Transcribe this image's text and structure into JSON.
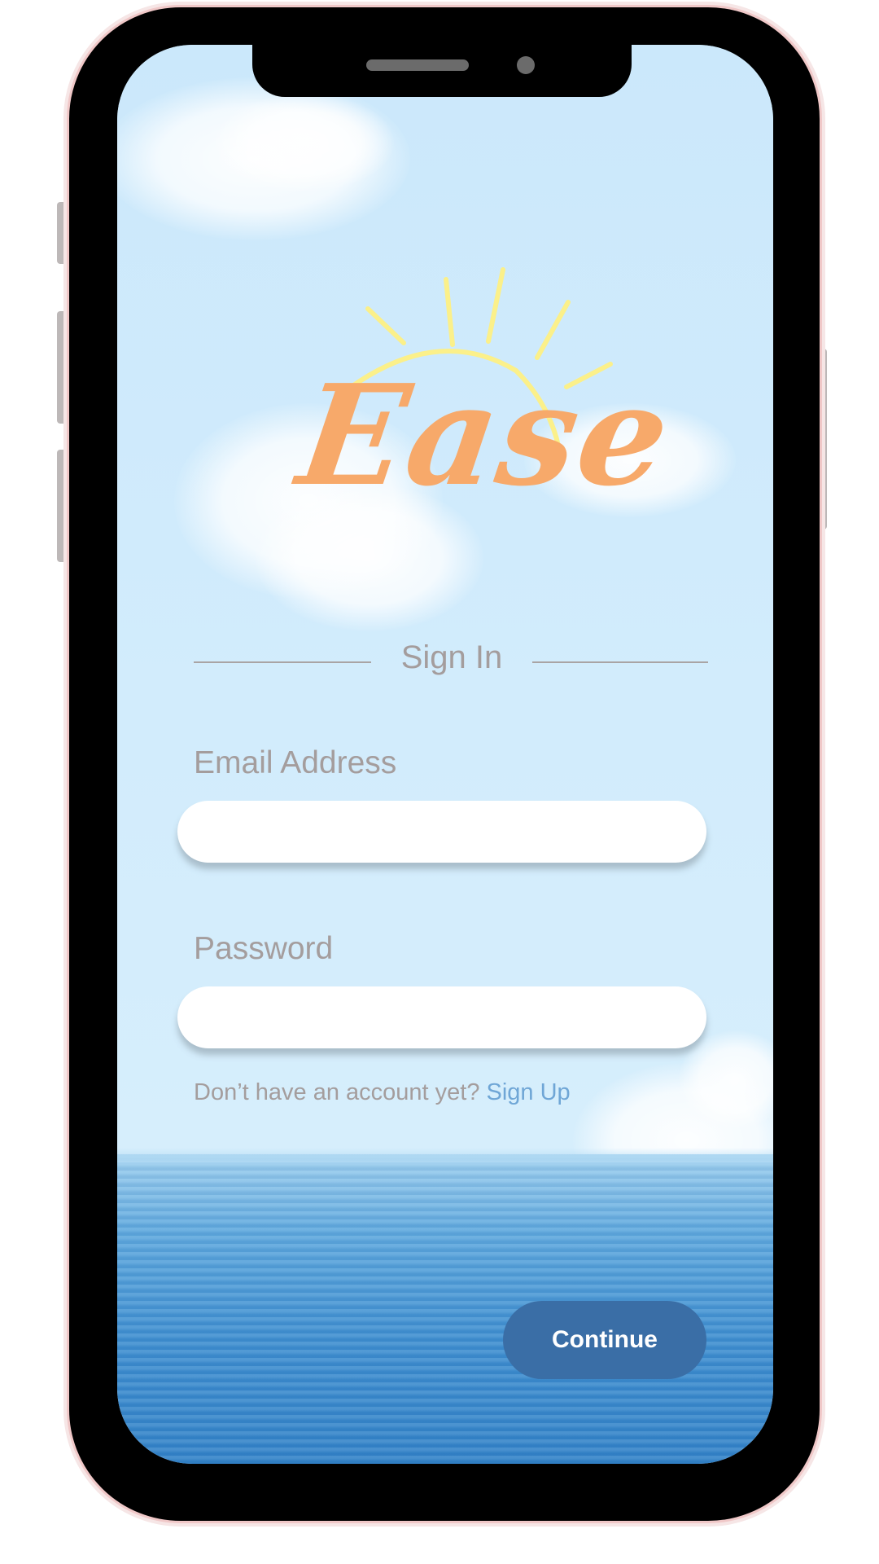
{
  "app": {
    "logo_text": "Ease",
    "logo_icon": "sun-icon",
    "colors": {
      "logo": "#f7a96a",
      "sun": "#fbf08a",
      "sky": "#cfeafb",
      "sea": "#3f8fd0",
      "label_text": "#a49d9d",
      "link": "#6fa6d6",
      "button": "#3a6ea6"
    }
  },
  "sign_in": {
    "title": "Sign In",
    "email_label": "Email Address",
    "email_value": "",
    "password_label": "Password",
    "password_value": "",
    "no_account_text": "Don’t have an account yet? ",
    "sign_up_link": "Sign Up",
    "continue_label": "Continue"
  }
}
